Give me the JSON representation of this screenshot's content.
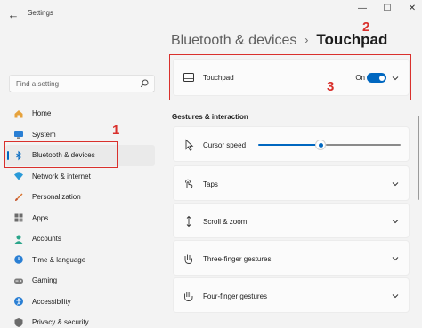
{
  "window": {
    "title": "Settings",
    "back_glyph": "←",
    "min_glyph": "—",
    "max_glyph": "☐",
    "close_glyph": "✕"
  },
  "search": {
    "placeholder": "Find a setting"
  },
  "sidebar": {
    "items": [
      {
        "label": "Home",
        "icon": "home-icon"
      },
      {
        "label": "System",
        "icon": "monitor-icon"
      },
      {
        "label": "Bluetooth & devices",
        "icon": "bluetooth-icon",
        "selected": true
      },
      {
        "label": "Network & internet",
        "icon": "wifi-icon"
      },
      {
        "label": "Personalization",
        "icon": "brush-icon"
      },
      {
        "label": "Apps",
        "icon": "apps-icon"
      },
      {
        "label": "Accounts",
        "icon": "person-icon"
      },
      {
        "label": "Time & language",
        "icon": "globe-clock-icon"
      },
      {
        "label": "Gaming",
        "icon": "gamepad-icon"
      },
      {
        "label": "Accessibility",
        "icon": "accessibility-icon"
      },
      {
        "label": "Privacy & security",
        "icon": "shield-icon"
      }
    ]
  },
  "breadcrumb": {
    "parent": "Bluetooth & devices",
    "separator": "›",
    "current": "Touchpad"
  },
  "touchpad": {
    "label": "Touchpad",
    "state_label": "On",
    "on": true
  },
  "gestures": {
    "section_title": "Gestures & interaction",
    "cursor_speed_label": "Cursor speed",
    "cursor_speed_value": 0.44,
    "items": [
      {
        "label": "Taps",
        "icon": "tap-icon"
      },
      {
        "label": "Scroll & zoom",
        "icon": "scroll-zoom-icon"
      },
      {
        "label": "Three-finger gestures",
        "icon": "three-finger-icon"
      },
      {
        "label": "Four-finger gestures",
        "icon": "four-finger-icon"
      }
    ]
  },
  "annotations": [
    "1",
    "2",
    "3"
  ],
  "colors": {
    "accent": "#0067c0",
    "annotation": "#d9302c"
  }
}
